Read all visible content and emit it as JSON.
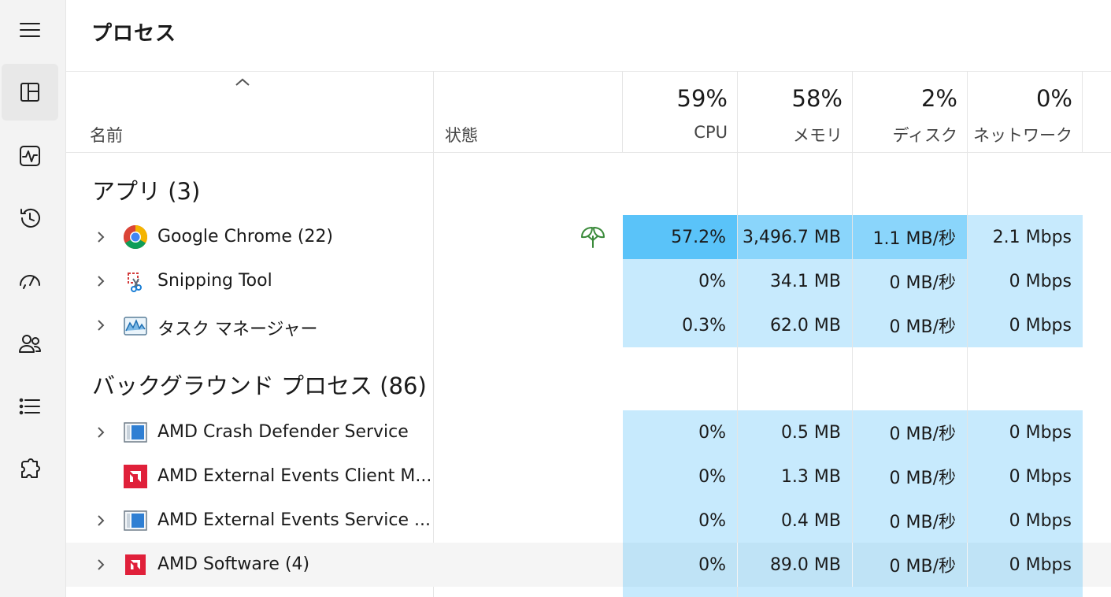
{
  "page_title": "プロセス",
  "columns": {
    "name": "名前",
    "status": "状態",
    "cpu": {
      "pct": "59%",
      "label": "CPU"
    },
    "memory": {
      "pct": "58%",
      "label": "メモリ"
    },
    "disk": {
      "pct": "2%",
      "label": "ディスク"
    },
    "network": {
      "pct": "0%",
      "label": "ネットワーク"
    }
  },
  "groups": {
    "apps": {
      "title": "アプリ (3)"
    },
    "background": {
      "title": "バックグラウンド プロセス (86)"
    }
  },
  "rows": [
    {
      "name": "Google Chrome (22)",
      "icon": "chrome-icon",
      "cpu": "57.2%",
      "mem": "3,496.7 MB",
      "disk": "1.1 MB/秒",
      "net": "2.1 Mbps"
    },
    {
      "name": "Snipping Tool",
      "icon": "snipping-tool-icon",
      "cpu": "0%",
      "mem": "34.1 MB",
      "disk": "0 MB/秒",
      "net": "0 Mbps"
    },
    {
      "name": "タスク マネージャー",
      "icon": "task-manager-icon",
      "cpu": "0.3%",
      "mem": "62.0 MB",
      "disk": "0 MB/秒",
      "net": "0 Mbps"
    },
    {
      "name": "AMD Crash Defender Service",
      "icon": "service-window-icon",
      "cpu": "0%",
      "mem": "0.5 MB",
      "disk": "0 MB/秒",
      "net": "0 Mbps"
    },
    {
      "name": "AMD External Events Client M...",
      "icon": "amd-logo-icon",
      "cpu": "0%",
      "mem": "1.3 MB",
      "disk": "0 MB/秒",
      "net": "0 Mbps"
    },
    {
      "name": "AMD External Events Service ...",
      "icon": "service-window-icon",
      "cpu": "0%",
      "mem": "0.4 MB",
      "disk": "0 MB/秒",
      "net": "0 Mbps"
    },
    {
      "name": "AMD Software (4)",
      "icon": "amd-logo-icon",
      "cpu": "0%",
      "mem": "89.0 MB",
      "disk": "0 MB/秒",
      "net": "0 Mbps"
    }
  ],
  "colors": {
    "heat_high": "#5ac3f9",
    "heat_mid": "#8ad5fb",
    "heat_low": "#c7eafd",
    "heat_hover": "#bfe3f6",
    "eco_leaf": "#3a8a3a"
  }
}
